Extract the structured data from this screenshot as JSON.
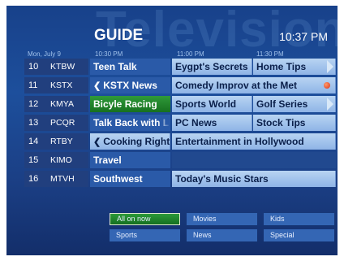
{
  "watermark": "Television",
  "title": "GUIDE",
  "clock": "10:37 PM",
  "header": {
    "date": "Mon, July 9",
    "t1": "10:30 PM",
    "t2": "11:00 PM",
    "t3": "11:30 PM"
  },
  "channels": [
    {
      "num": "10",
      "call": "KTBW",
      "p1": "Teen Talk",
      "p2": "Eygpt's Secrets",
      "p3": "Home Tips"
    },
    {
      "num": "11",
      "call": "KSTX",
      "p1": "KSTX News",
      "p2": "Comedy Improv at the Met"
    },
    {
      "num": "12",
      "call": "KMYA",
      "p1": "Bicyle Racing",
      "p2": "Sports World",
      "p3": "Golf Series"
    },
    {
      "num": "13",
      "call": "PCQR",
      "p1": "Talk Back with L",
      "p2": "PC News",
      "p3": "Stock Tips"
    },
    {
      "num": "14",
      "call": "RTBY",
      "p1": "Cooking Right",
      "p2": "Entertainment in Hollywood"
    },
    {
      "num": "15",
      "call": "KIMO",
      "p1": "Travel"
    },
    {
      "num": "16",
      "call": "MTVH",
      "p1": "Southwest",
      "p2": "Today's Music Stars"
    }
  ],
  "filters": [
    "All on now",
    "Movies",
    "Kids",
    "Sports",
    "News",
    "Special"
  ],
  "colors": {
    "selected": "#2f9a3a",
    "record": "#d8321a",
    "background": "#1d4f9c"
  },
  "icons": {
    "more_right": "triangle-right-icon",
    "more_left": "chevron-left-icon",
    "record": "record-dot-icon"
  }
}
